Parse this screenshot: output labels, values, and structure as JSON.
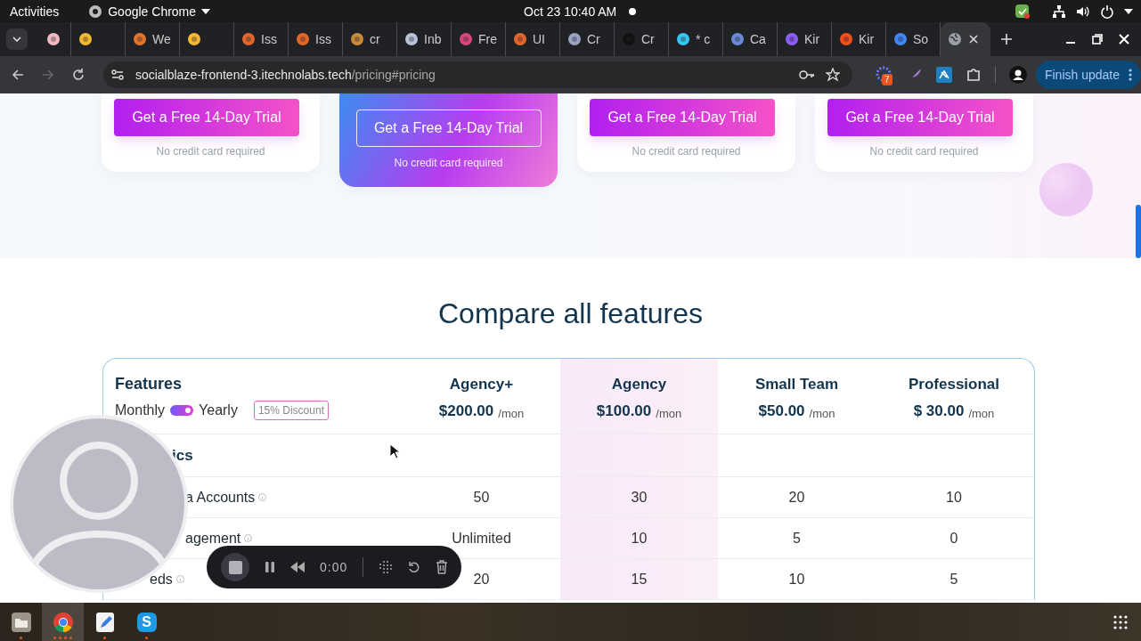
{
  "top_bar": {
    "activities": "Activities",
    "app_menu": "Google Chrome",
    "clock": "Oct 23  10:40 AM"
  },
  "tabs": [
    {
      "selected": false
    },
    {
      "selected": false
    },
    {
      "title": "We",
      "selected": false
    },
    {
      "selected": false
    },
    {
      "title": "Iss",
      "selected": false
    },
    {
      "title": "Iss",
      "selected": false
    },
    {
      "title": "cr",
      "selected": false
    },
    {
      "title": "Inb",
      "selected": false
    },
    {
      "title": "Fre",
      "selected": false
    },
    {
      "title": "UI",
      "selected": false
    },
    {
      "title": "Cr",
      "selected": false
    },
    {
      "title": "Cr",
      "selected": false
    },
    {
      "title": "* c",
      "selected": false
    },
    {
      "title": "Ca",
      "selected": false
    },
    {
      "title": "Kir",
      "selected": false
    },
    {
      "title": "Kir",
      "selected": false
    },
    {
      "title": "So",
      "selected": false
    },
    {
      "selected": true
    }
  ],
  "toolbar": {
    "url_host": "socialblaze-frontend-3.itechnolabs.tech",
    "url_path": "/pricing#pricing",
    "extension_badge": "7",
    "update_button": "Finish update"
  },
  "plan_cards": [
    {
      "button": "Get a Free 14-Day Trial",
      "note": "No credit card required",
      "featured": false
    },
    {
      "button": "Get a Free 14-Day Trial",
      "note": "No credit card required",
      "featured": true
    },
    {
      "button": "Get a Free 14-Day Trial",
      "note": "No credit card required",
      "featured": false
    },
    {
      "button": "Get a Free 14-Day Trial",
      "note": "No credit card required",
      "featured": false
    }
  ],
  "compare": {
    "title": "Compare all features",
    "features_label": "Features",
    "billing": {
      "monthly": "Monthly",
      "yearly": "Yearly",
      "yearly_on": true,
      "discount": "15% Discount"
    },
    "plans": [
      {
        "name": "Agency+",
        "price": "$200.00",
        "period": "/mon",
        "highlighted": false
      },
      {
        "name": "Agency",
        "price": "$100.00",
        "period": "/mon",
        "highlighted": true
      },
      {
        "name": "Small Team",
        "price": "$50.00",
        "period": "/mon",
        "highlighted": false
      },
      {
        "name": "Professional",
        "price": "$ 30.00",
        "period": "/mon",
        "highlighted": false
      }
    ],
    "rows": [
      {
        "kind": "section",
        "label": "ics"
      },
      {
        "kind": "feature",
        "label": "a Accounts",
        "values": [
          "50",
          "30",
          "20",
          "10"
        ]
      },
      {
        "kind": "feature",
        "label": "agement",
        "values": [
          "Unlimited",
          "10",
          "5",
          "0"
        ]
      },
      {
        "kind": "feature",
        "label": "eds",
        "values": [
          "20",
          "15",
          "10",
          "5"
        ]
      }
    ]
  },
  "recorder": {
    "time": "0:00"
  },
  "taskbar": {
    "apps": [
      {
        "kind": "files",
        "selected": false
      },
      {
        "kind": "browser",
        "selected": true
      },
      {
        "kind": "editor",
        "selected": false
      },
      {
        "kind": "chat",
        "selected": false,
        "glyph": "S"
      }
    ]
  }
}
